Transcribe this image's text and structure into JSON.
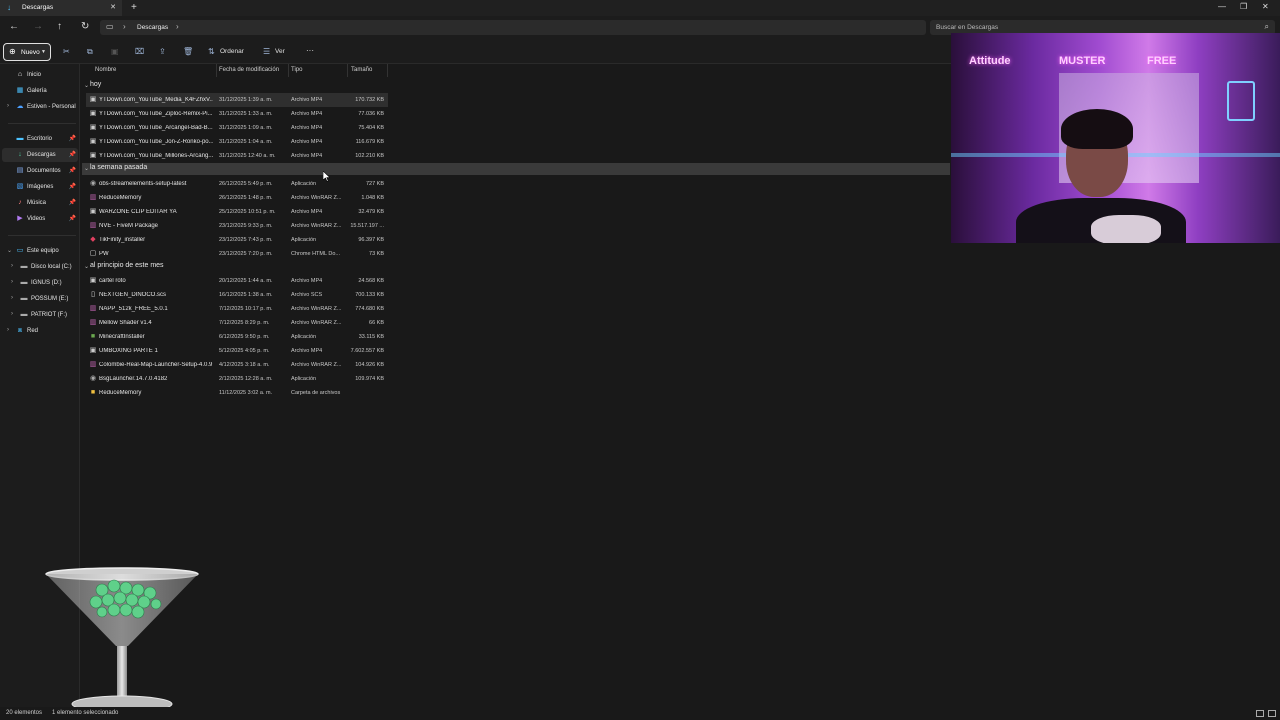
{
  "window": {
    "tab_title": "Descargas",
    "new_tab": "+",
    "controls": [
      "—",
      "❐",
      "✕"
    ]
  },
  "address": {
    "crumb": "Descargas",
    "search_placeholder": "Buscar en Descargas"
  },
  "toolbar": {
    "new_label": "Nuevo",
    "sort_label": "Ordenar",
    "view_label": "Ver",
    "more_label": "···"
  },
  "sidebar": {
    "items": [
      {
        "label": "Inicio",
        "icon": "home-icon",
        "color": "#e8e8e8"
      },
      {
        "label": "Galería",
        "icon": "gallery-icon",
        "color": "#4cc2ff"
      },
      {
        "label": "Estiven - Personal",
        "icon": "cloud-icon",
        "color": "#4ca0ff"
      },
      {
        "label": "Escritorio",
        "icon": "desktop-icon",
        "color": "#4cc2ff"
      },
      {
        "label": "Descargas",
        "icon": "download-icon",
        "color": "#4cd0a0"
      },
      {
        "label": "Documentos",
        "icon": "document-icon",
        "color": "#8ab4f8"
      },
      {
        "label": "Imágenes",
        "icon": "pictures-icon",
        "color": "#4ca8ff"
      },
      {
        "label": "Música",
        "icon": "music-icon",
        "color": "#f07a7a"
      },
      {
        "label": "Videos",
        "icon": "videos-icon",
        "color": "#b07af0"
      },
      {
        "label": "Este equipo",
        "icon": "computer-icon",
        "color": "#4cc2ff"
      },
      {
        "label": "Disco local (C:)",
        "icon": "drive-icon",
        "color": "#aaa"
      },
      {
        "label": "IGNUS (D:)",
        "icon": "drive-icon",
        "color": "#aaa"
      },
      {
        "label": "POSSUM (E:)",
        "icon": "drive-icon",
        "color": "#aaa"
      },
      {
        "label": "PATRIOT (F:)",
        "icon": "drive-icon",
        "color": "#aaa"
      },
      {
        "label": "Red",
        "icon": "network-icon",
        "color": "#4cc2ff"
      }
    ]
  },
  "columns": {
    "name": "Nombre",
    "date": "Fecha de modificación",
    "type": "Tipo",
    "size": "Tamaño"
  },
  "groups": [
    {
      "label": "hoy",
      "rows": [
        {
          "name": "YTDown.com_YouTube_Media_K4FZhxV...",
          "date": "31/12/2025 1:39 a. m.",
          "type": "Archivo MP4",
          "size": "170.732 KB",
          "icon": "video-file-icon"
        },
        {
          "name": "YTDown.com_YouTube_Ziploc-Remix-Pi...",
          "date": "31/12/2025 1:33 a. m.",
          "type": "Archivo MP4",
          "size": "77.036 KB",
          "icon": "video-file-icon"
        },
        {
          "name": "YTDown.com_YouTube_Arcangel-Bad-B...",
          "date": "31/12/2025 1:09 a. m.",
          "type": "Archivo MP4",
          "size": "75.404 KB",
          "icon": "video-file-icon"
        },
        {
          "name": "YTDown.com_YouTube_Jon-Z-Ronko-po...",
          "date": "31/12/2025 1:04 a. m.",
          "type": "Archivo MP4",
          "size": "116.679 KB",
          "icon": "video-file-icon"
        },
        {
          "name": "YTDown.com_YouTube_Millones-Arcang...",
          "date": "31/12/2025 12:40 a. m.",
          "type": "Archivo MP4",
          "size": "102.210 KB",
          "icon": "video-file-icon"
        }
      ]
    },
    {
      "label": "la semana pasada",
      "rows": [
        {
          "name": "obs-streamelements-setup-latest",
          "date": "26/12/2025 5:49 p. m.",
          "type": "Aplicación",
          "size": "727 KB",
          "icon": "app-icon"
        },
        {
          "name": "ReduceMemory",
          "date": "26/12/2025 1:48 p. m.",
          "type": "Archivo WinRAR Z...",
          "size": "1.048 KB",
          "icon": "winrar-icon"
        },
        {
          "name": "WARZONE CLIP EDITAR YA",
          "date": "25/12/2025 10:51 p. m.",
          "type": "Archivo MP4",
          "size": "32.479 KB",
          "icon": "video-file-icon"
        },
        {
          "name": "NVE - FiveM Package",
          "date": "23/12/2025 9:33 p. m.",
          "type": "Archivo WinRAR Z...",
          "size": "15.517.197 ...",
          "icon": "winrar-icon"
        },
        {
          "name": "TikFinity_installer",
          "date": "23/12/2025 7:43 p. m.",
          "type": "Aplicación",
          "size": "96.397 KB",
          "icon": "app-icon"
        },
        {
          "name": "PW",
          "date": "23/12/2025 7:20 p. m.",
          "type": "Chrome HTML Do...",
          "size": "73 KB",
          "icon": "chrome-doc-icon"
        }
      ]
    },
    {
      "label": "al principio de este mes",
      "rows": [
        {
          "name": "cartel roto",
          "date": "20/12/2025 1:44 a. m.",
          "type": "Archivo MP4",
          "size": "24.568 KB",
          "icon": "video-file-icon"
        },
        {
          "name": "NEXTGEN_DINOCO.scs",
          "date": "16/12/2025 1:38 a. m.",
          "type": "Archivo SCS",
          "size": "700.133 KB",
          "icon": "file-icon"
        },
        {
          "name": "NAPP_512k_FREE_5.0.1",
          "date": "7/12/2025 10:17 p. m.",
          "type": "Archivo WinRAR Z...",
          "size": "774.680 KB",
          "icon": "winrar-icon"
        },
        {
          "name": "Mellow Shader v1.4",
          "date": "7/12/2025 8:29 p. m.",
          "type": "Archivo WinRAR Z...",
          "size": "66 KB",
          "icon": "winrar-icon"
        },
        {
          "name": "MinecraftInstaller",
          "date": "6/12/2025 9:50 p. m.",
          "type": "Aplicación",
          "size": "33.115 KB",
          "icon": "minecraft-icon"
        },
        {
          "name": "UMBOXING PARTE 1",
          "date": "5/12/2025 4:05 p. m.",
          "type": "Archivo MP4",
          "size": "7.602.557 KB",
          "icon": "video-file-icon"
        },
        {
          "name": "Colombie-Real-Map-Launcher-Setup-4.0.9",
          "date": "4/12/2025 3:18 a. m.",
          "type": "Archivo WinRAR Z...",
          "size": "104.926 KB",
          "icon": "winrar-icon"
        },
        {
          "name": "BsgLauncher.14.7.0.4182",
          "date": "2/12/2025 12:28 a. m.",
          "type": "Aplicación",
          "size": "109.974 KB",
          "icon": "app-icon"
        },
        {
          "name": "ReduceMemory",
          "date": "11/12/2025 3:02 a. m.",
          "type": "Carpeta de archivos",
          "size": "",
          "icon": "folder-icon"
        }
      ]
    }
  ],
  "status": {
    "count": "20 elementos",
    "selected": "1 elemento seleccionado"
  },
  "webcam": {
    "neon_left": "Attitude",
    "neon_mid": "MUSTER",
    "neon_right": "FREE"
  }
}
